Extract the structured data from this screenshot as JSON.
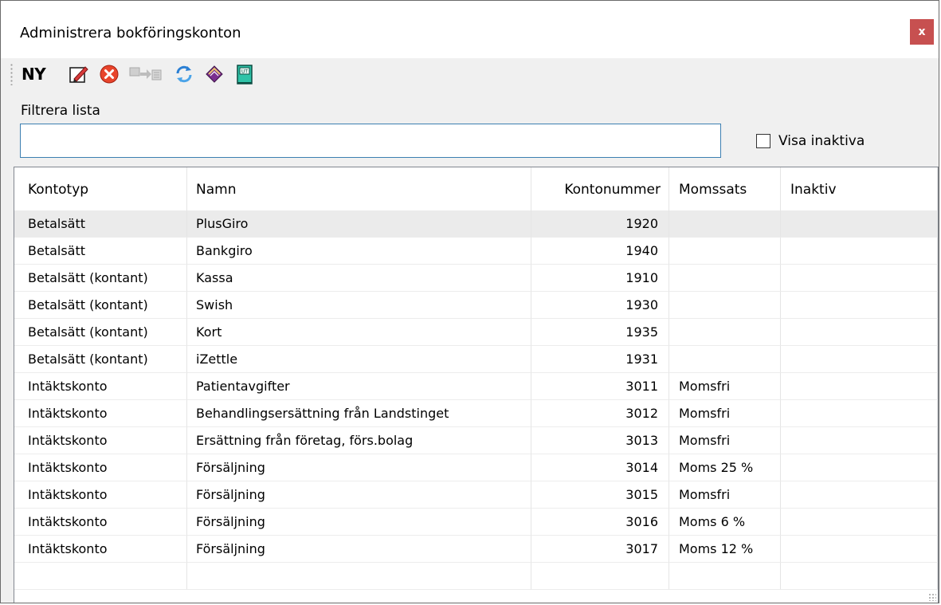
{
  "window": {
    "title": "Administrera bokföringskonton",
    "close_label": "x"
  },
  "toolbar": {
    "new_label": "NY",
    "icons": [
      "edit-icon",
      "delete-icon",
      "move-disabled-icon",
      "refresh-icon",
      "book-icon",
      "exit-door-icon"
    ]
  },
  "filter": {
    "label": "Filtrera lista",
    "value": "",
    "placeholder": ""
  },
  "show_inactive": {
    "label": "Visa inaktiva",
    "checked": false
  },
  "table": {
    "columns": [
      "Kontotyp",
      "Namn",
      "Kontonummer",
      "Momssats",
      "Inaktiv"
    ],
    "rows": [
      {
        "kontotyp": "Betalsätt",
        "namn": "PlusGiro",
        "kontonummer": "1920",
        "momssats": "",
        "inaktiv": ""
      },
      {
        "kontotyp": "Betalsätt",
        "namn": "Bankgiro",
        "kontonummer": "1940",
        "momssats": "",
        "inaktiv": ""
      },
      {
        "kontotyp": "Betalsätt (kontant)",
        "namn": "Kassa",
        "kontonummer": "1910",
        "momssats": "",
        "inaktiv": ""
      },
      {
        "kontotyp": "Betalsätt (kontant)",
        "namn": "Swish",
        "kontonummer": "1930",
        "momssats": "",
        "inaktiv": ""
      },
      {
        "kontotyp": "Betalsätt (kontant)",
        "namn": "Kort",
        "kontonummer": "1935",
        "momssats": "",
        "inaktiv": ""
      },
      {
        "kontotyp": "Betalsätt (kontant)",
        "namn": "iZettle",
        "kontonummer": "1931",
        "momssats": "",
        "inaktiv": ""
      },
      {
        "kontotyp": "Intäktskonto",
        "namn": "Patientavgifter",
        "kontonummer": "3011",
        "momssats": "Momsfri",
        "inaktiv": ""
      },
      {
        "kontotyp": "Intäktskonto",
        "namn": "Behandlingsersättning från Landstinget",
        "kontonummer": "3012",
        "momssats": "Momsfri",
        "inaktiv": ""
      },
      {
        "kontotyp": "Intäktskonto",
        "namn": "Ersättning från företag, förs.bolag",
        "kontonummer": "3013",
        "momssats": "Momsfri",
        "inaktiv": ""
      },
      {
        "kontotyp": "Intäktskonto",
        "namn": "Försäljning",
        "kontonummer": "3014",
        "momssats": "Moms 25 %",
        "inaktiv": ""
      },
      {
        "kontotyp": "Intäktskonto",
        "namn": "Försäljning",
        "kontonummer": "3015",
        "momssats": "Momsfri",
        "inaktiv": ""
      },
      {
        "kontotyp": "Intäktskonto",
        "namn": "Försäljning",
        "kontonummer": "3016",
        "momssats": "Moms 6 %",
        "inaktiv": ""
      },
      {
        "kontotyp": "Intäktskonto",
        "namn": "Försäljning",
        "kontonummer": "3017",
        "momssats": "Moms 12 %",
        "inaktiv": ""
      }
    ],
    "selected_row": 0
  },
  "colors": {
    "close_button": "#c75050",
    "input_border": "#3c7fb1",
    "selected_row": "#ebebeb"
  }
}
